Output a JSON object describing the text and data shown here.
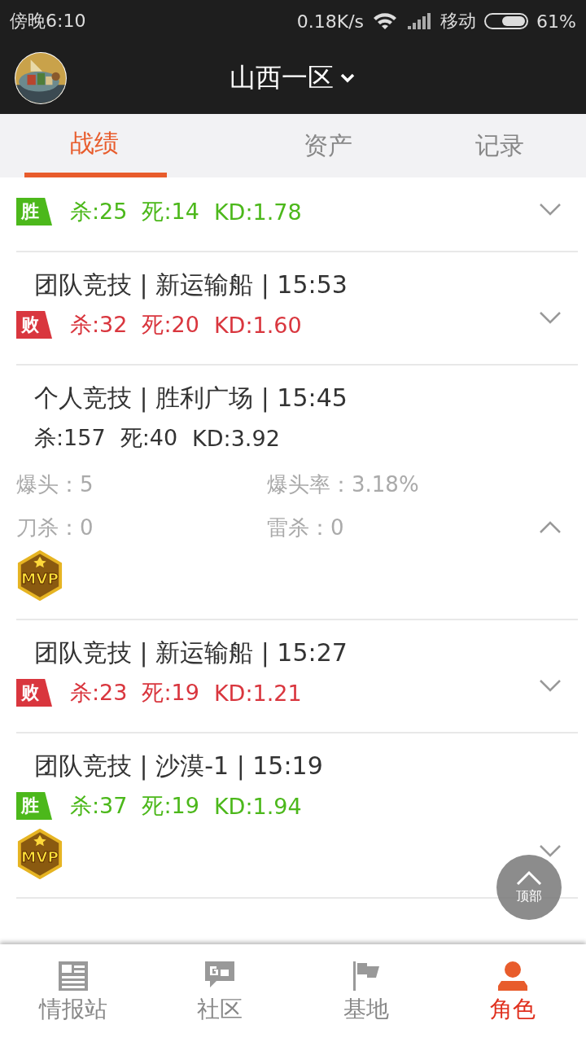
{
  "status_bar": {
    "time": "傍晚6:10",
    "speed": "0.18K/s",
    "carrier": "移动",
    "battery": "61%"
  },
  "header": {
    "title": "山西一区"
  },
  "tabs": [
    {
      "label": "战绩",
      "selected": true
    },
    {
      "label": "资产",
      "selected": false
    },
    {
      "label": "记录",
      "selected": false
    }
  ],
  "matches": [
    {
      "won": true,
      "result_label": "胜",
      "stats": [
        "杀:25",
        "死:14",
        "KD:1.78"
      ],
      "expanded": false
    },
    {
      "title": "团队竞技 | 新运输船 | 15:53",
      "won": false,
      "result_label": "败",
      "stats": [
        "杀:32",
        "死:20",
        "KD:1.60"
      ],
      "expanded": false
    },
    {
      "title": "个人竞技 | 胜利广场 | 15:45",
      "stats": [
        "杀:157",
        "死:40",
        "KD:3.92"
      ],
      "expanded": true,
      "details": [
        "爆头：5",
        "爆头率：3.18%",
        "刀杀：0",
        "雷杀：0"
      ],
      "mvp": "MVP"
    },
    {
      "title": "团队竞技 | 新运输船 | 15:27",
      "won": false,
      "result_label": "败",
      "stats": [
        "杀:23",
        "死:19",
        "KD:1.21"
      ],
      "expanded": false
    },
    {
      "title": "团队竞技 | 沙漠-1 | 15:19",
      "won": true,
      "result_label": "胜",
      "stats": [
        "杀:37",
        "死:19",
        "KD:1.94"
      ],
      "expanded": false,
      "mvp": "MVP"
    }
  ],
  "back_to_top": {
    "label": "顶部"
  },
  "bottom_nav": [
    {
      "label": "情报站",
      "kind": "news",
      "selected": false
    },
    {
      "label": "社区",
      "kind": "chat",
      "selected": false
    },
    {
      "label": "基地",
      "kind": "flag",
      "selected": false
    },
    {
      "label": "角色",
      "kind": "person",
      "selected": true
    }
  ]
}
